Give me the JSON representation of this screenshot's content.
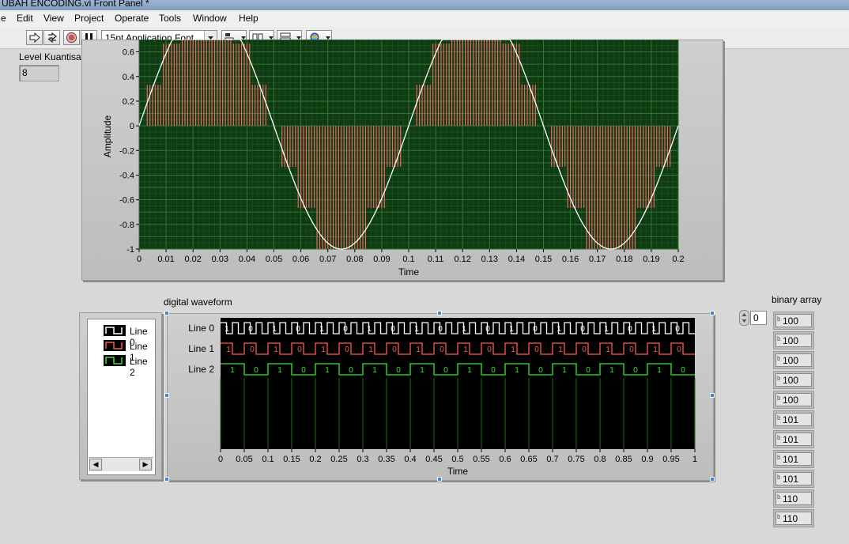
{
  "window": {
    "title": "UBAH ENCODING.vi Front Panel *"
  },
  "menu": [
    "e",
    "Edit",
    "View",
    "Project",
    "Operate",
    "Tools",
    "Window",
    "Help"
  ],
  "toolbar": {
    "font": "15pt Application Font"
  },
  "level": {
    "label": "Level Kuantisasi",
    "value": "8"
  },
  "chart_data": [
    {
      "type": "line",
      "xlabel": "Time",
      "ylabel": "Amplitude",
      "xlim": [
        0,
        0.2
      ],
      "ylim": [
        -1,
        0.7
      ],
      "x_ticks": [
        "0",
        "0.01",
        "0.02",
        "0.03",
        "0.04",
        "0.05",
        "0.06",
        "0.07",
        "0.08",
        "0.09",
        "0.1",
        "0.11",
        "0.12",
        "0.13",
        "0.14",
        "0.15",
        "0.16",
        "0.17",
        "0.18",
        "0.19",
        "0.2"
      ],
      "y_ticks": [
        "0.6",
        "0.4",
        "0.2",
        "0",
        "-0.2",
        "-0.4",
        "-0.6",
        "-0.8",
        "-1"
      ],
      "series": [
        {
          "kind": "sine",
          "frequency_hz": 10,
          "amplitude": 1,
          "color": "#ffffff"
        },
        {
          "kind": "quantized-stems",
          "levels": 8,
          "color": "#e86a62"
        }
      ],
      "background": "#0f3a14",
      "grid": true
    },
    {
      "type": "digital-waveform",
      "title": "digital waveform",
      "xlabel": "Time",
      "xlim": [
        0,
        1
      ],
      "x_ticks": [
        "0",
        "0.05",
        "0.1",
        "0.15",
        "0.2",
        "0.25",
        "0.3",
        "0.35",
        "0.4",
        "0.45",
        "0.5",
        "0.55",
        "0.6",
        "0.65",
        "0.7",
        "0.75",
        "0.8",
        "0.85",
        "0.9",
        "0.95",
        "1"
      ],
      "lines": [
        {
          "name": "Line 0",
          "color": "#ffffff",
          "label_values": [
            "1",
            "0",
            "1",
            "0",
            "1",
            "0",
            "1",
            "0",
            "1",
            "0",
            "1",
            "0",
            "1",
            "0",
            "1",
            "0",
            "1",
            "0",
            "1",
            "0"
          ]
        },
        {
          "name": "Line 1",
          "color": "#ff5a4e",
          "label_values": [
            "1",
            "0",
            "1",
            "0",
            "1",
            "0",
            "1",
            "0",
            "1",
            "0",
            "1",
            "0",
            "1",
            "0",
            "1",
            "0",
            "1",
            "0",
            "1",
            "0"
          ]
        },
        {
          "name": "Line 2",
          "color": "#33e633",
          "label_values": [
            "1",
            "0",
            "1",
            "0",
            "1",
            "0",
            "1",
            "0",
            "1",
            "0",
            "1",
            "0",
            "1",
            "0",
            "1",
            "0",
            "1",
            "0",
            "1",
            "0"
          ]
        }
      ]
    }
  ],
  "binary_array": {
    "label": "binary array",
    "index": "0",
    "values": [
      "100",
      "100",
      "100",
      "100",
      "100",
      "101",
      "101",
      "101",
      "101",
      "110",
      "110"
    ]
  }
}
